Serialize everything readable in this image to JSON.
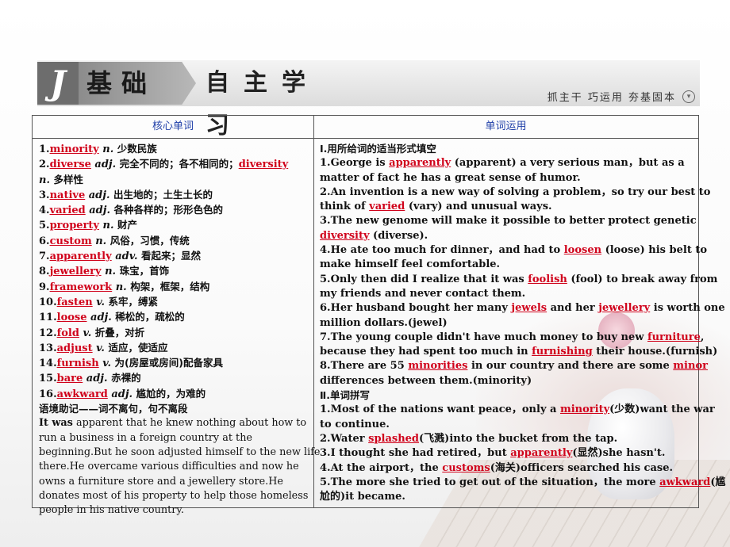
{
  "banner": {
    "logo_letter": "J",
    "title_main": "基础",
    "title_sub": "自主学习",
    "motto": "抓主干  巧运用  夯基固本",
    "collapse_glyph": "▾"
  },
  "table": {
    "left_header": "核心单词",
    "right_header": "单词运用"
  },
  "vocab": [
    {
      "n": "1.",
      "w": "minority",
      "p": "n.",
      "m": "少数民族"
    },
    {
      "n": "2.",
      "w": "diverse",
      "p": "adj.",
      "m": "完全不同的；各不相同的；",
      "w2": "diversity",
      "p2": "n.",
      "m2": "多样性"
    },
    {
      "n": "3.",
      "w": "native",
      "p": "adj.",
      "m": "出生地的；土生土长的"
    },
    {
      "n": "4.",
      "w": "varied",
      "p": "adj.",
      "m": "各种各样的；形形色色的"
    },
    {
      "n": "5.",
      "w": "property",
      "p": "n.",
      "m": "财产"
    },
    {
      "n": "6.",
      "w": "custom",
      "p": "n.",
      "m": "风俗，习惯，传统"
    },
    {
      "n": "7.",
      "w": "apparently",
      "p": "adv.",
      "m": "看起来；显然"
    },
    {
      "n": "8.",
      "w": "jewellery",
      "p": "n.",
      "m": "珠宝，首饰"
    },
    {
      "n": "9.",
      "w": "framework",
      "p": "n.",
      "m": "构架，框架，结构"
    },
    {
      "n": "10.",
      "w": "fasten",
      "p": "v.",
      "m": "系牢，缚紧"
    },
    {
      "n": "11.",
      "w": "loose",
      "p": "adj.",
      "m": "稀松的，疏松的"
    },
    {
      "n": "12.",
      "w": "fold",
      "p": "v.",
      "m": "折叠，对折"
    },
    {
      "n": "13.",
      "w": "adjust",
      "p": "v.",
      "m": "适应，使适应"
    },
    {
      "n": "14.",
      "w": "furnish",
      "p": "v.",
      "m": "为(房屋或房间)配备家具"
    },
    {
      "n": "15.",
      "w": "bare",
      "p": "adj.",
      "m": "赤裸的"
    },
    {
      "n": "16.",
      "w": "awkward",
      "p": "adj.",
      "m": "尴尬的，为难的"
    }
  ],
  "context_heading": "语境助记——词不离句，句不离段",
  "context_lead": "It was",
  "context_lines": [
    " apparent that he knew nothing about how to",
    "run a business in a foreign country at the",
    "beginning.But he soon adjusted himself to the new life",
    "there.He overcame various difficulties and now he",
    "owns a furniture store and a jewellery store.He",
    "donates most of his property to help those homeless",
    "people in his native country."
  ],
  "section1_title": "Ⅰ.用所给词的适当形式填空",
  "section1_lines": [
    [
      {
        "t": "1.George is "
      },
      {
        "a": "apparently"
      },
      {
        "t": " (apparent) a very serious man，but as a"
      }
    ],
    [
      {
        "t": "matter of fact he has a great sense of humor."
      }
    ],
    [
      {
        "t": "2.An invention is a new way of solving a problem，so try our best to"
      }
    ],
    [
      {
        "t": "think of "
      },
      {
        "a": "varied"
      },
      {
        "t": " (vary) and unusual ways."
      }
    ],
    [
      {
        "t": "3.The new genome will make it possible to better protect genetic"
      }
    ],
    [
      {
        "a": "diversity"
      },
      {
        "t": " (diverse)."
      }
    ],
    [
      {
        "t": "4.He ate too much for dinner，and had to "
      },
      {
        "a": "loosen"
      },
      {
        "t": " (loose) his belt to"
      }
    ],
    [
      {
        "t": "make himself feel comfortable."
      }
    ],
    [
      {
        "t": "5.Only then did I realize that it was "
      },
      {
        "a": "foolish"
      },
      {
        "t": " (fool) to break away from"
      }
    ],
    [
      {
        "t": "my friends and never contact them."
      }
    ],
    [
      {
        "t": "6.Her husband bought her many "
      },
      {
        "a": "jewels"
      },
      {
        "t": " and her "
      },
      {
        "a": "jewellery"
      },
      {
        "t": " is worth one"
      }
    ],
    [
      {
        "t": "million dollars.(jewel)"
      }
    ],
    [
      {
        "t": "7.The young couple didn't have much money to buy new "
      },
      {
        "a": "furniture"
      },
      {
        "t": ","
      }
    ],
    [
      {
        "t": "because they had spent too much in "
      },
      {
        "a": "furnishing"
      },
      {
        "t": " their house.(furnish)"
      }
    ],
    [
      {
        "t": "8.There are 55 "
      },
      {
        "a": "minorities"
      },
      {
        "t": " in our country and there are some "
      },
      {
        "a": "minor"
      }
    ],
    [
      {
        "t": "differences between them.(minority)"
      }
    ]
  ],
  "section2_title": "Ⅱ.单词拼写",
  "section2_lines": [
    [
      {
        "t": "1.Most of the nations want peace，only a "
      },
      {
        "a": "minority"
      },
      {
        "t": "(少数)want the war"
      }
    ],
    [
      {
        "t": "to continue."
      }
    ],
    [
      {
        "t": "2.Water "
      },
      {
        "a": "splashed"
      },
      {
        "t": "(飞溅)into the bucket from the tap."
      }
    ],
    [
      {
        "t": "3.I thought she had retired，but "
      },
      {
        "a": "apparently"
      },
      {
        "t": "(显然)she hasn't."
      }
    ],
    [
      {
        "t": "4.At the airport，the "
      },
      {
        "a": "customs"
      },
      {
        "t": "(海关)officers searched his case."
      }
    ],
    [
      {
        "t": "5.The more she tried to get out of the situation，the more "
      },
      {
        "a": "awkward"
      },
      {
        "t": "(尴"
      }
    ],
    [
      {
        "t": "尬的)it became."
      }
    ]
  ]
}
